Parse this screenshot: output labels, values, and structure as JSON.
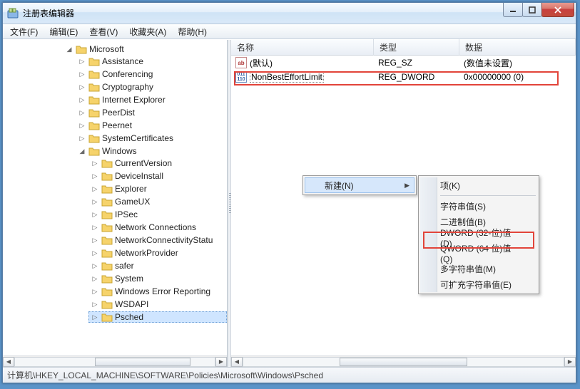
{
  "window": {
    "title": "注册表编辑器"
  },
  "menus": {
    "file": "文件(F)",
    "edit": "编辑(E)",
    "view": "查看(V)",
    "favorites": "收藏夹(A)",
    "help": "帮助(H)"
  },
  "tree": {
    "root": "Microsoft",
    "children": [
      "Assistance",
      "Conferencing",
      "Cryptography",
      "Internet Explorer",
      "PeerDist",
      "Peernet",
      "SystemCertificates"
    ],
    "windows": {
      "label": "Windows",
      "children": [
        "CurrentVersion",
        "DeviceInstall",
        "Explorer",
        "GameUX",
        "IPSec",
        "Network Connections",
        "NetworkConnectivityStatu",
        "NetworkProvider",
        "safer",
        "System",
        "Windows Error Reporting",
        "WSDAPI",
        "Psched"
      ]
    }
  },
  "list": {
    "columns": {
      "name": "名称",
      "type": "类型",
      "data": "数据"
    },
    "rows": [
      {
        "icon": "ab",
        "name": "(默认)",
        "type": "REG_SZ",
        "data": "(数值未设置)"
      },
      {
        "icon": "bin",
        "name": "NonBestEffortLimit",
        "type": "REG_DWORD",
        "data": "0x00000000 (0)"
      }
    ]
  },
  "context": {
    "new_label": "新建(N)",
    "submenu": [
      "项(K)",
      "字符串值(S)",
      "二进制值(B)",
      "DWORD (32-位)值(D)",
      "QWORD (64 位)值(Q)",
      "多字符串值(M)",
      "可扩充字符串值(E)"
    ]
  },
  "statusbar": "计算机\\HKEY_LOCAL_MACHINE\\SOFTWARE\\Policies\\Microsoft\\Windows\\Psched"
}
